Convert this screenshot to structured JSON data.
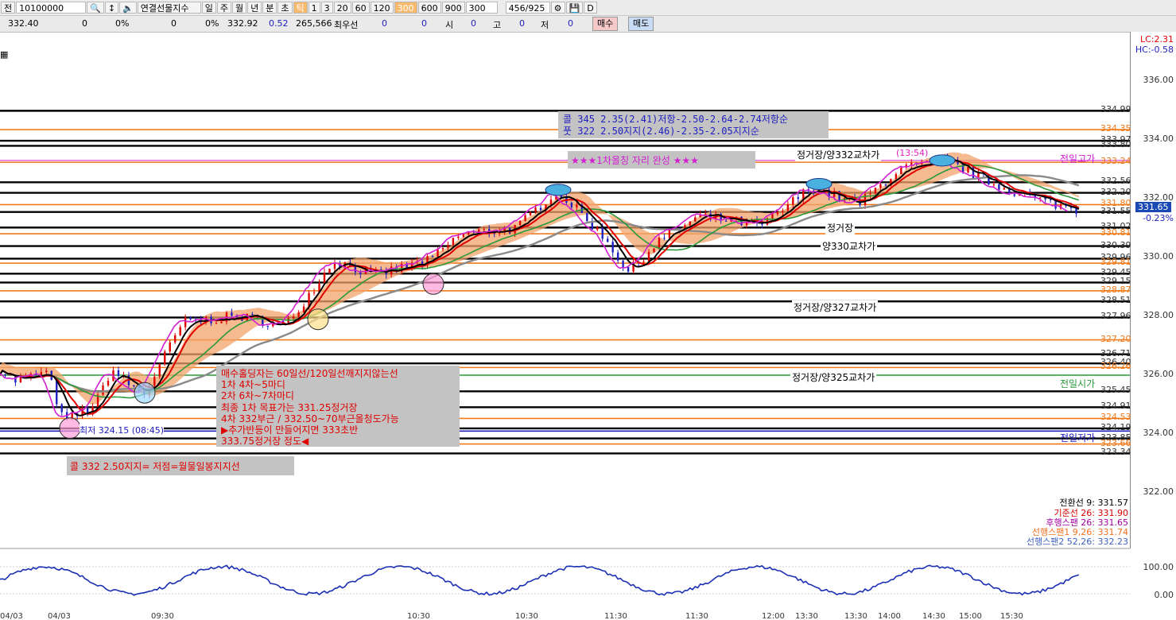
{
  "toolbar": {
    "mode": "전",
    "code": "10100000",
    "name": "연결선물지수",
    "periods": [
      "일",
      "주",
      "월",
      "년",
      "분",
      "초",
      "틱"
    ],
    "nums": [
      "1",
      "3",
      "20",
      "60",
      "120",
      "300",
      "600",
      "900"
    ],
    "count": "300",
    "paging": "456/925",
    "check": "D"
  },
  "quote": {
    "price1": "332.40",
    "v1": "0",
    "p1": "0%",
    "v2": "0",
    "p2": "0%",
    "last": "332.92",
    "chg": "0.52",
    "vol": "265,566",
    "label": "최우선",
    "z1": "0",
    "z2": "0",
    "si": "시",
    "z3": "0",
    "go": "고",
    "z4": "0",
    "jeo": "저",
    "z5": "0",
    "buy": "매수",
    "sell": "매도"
  },
  "axis": {
    "lc": "LC:2.31",
    "hc": "HC:-0.58",
    "ticks": [
      "336.00",
      "334.00",
      "332.00",
      "330.00",
      "328.00",
      "326.00",
      "324.00",
      "322.00"
    ],
    "current": "331.65",
    "current_pct": "-0.23%",
    "ind_ticks": [
      "100.00",
      "0.00"
    ]
  },
  "price_labels": [
    "334.99",
    "334.35",
    "333.97",
    "333.80",
    "333.24",
    "332.56",
    "332.20",
    "331.80",
    "331.55",
    "331.02",
    "330.81",
    "330.39",
    "329.96",
    "329.81",
    "329.45",
    "329.15",
    "328.87",
    "328.51",
    "327.96",
    "327.20",
    "326.71",
    "326.40",
    "326.26",
    "325.45",
    "324.91",
    "324.53",
    "324.19",
    "323.85",
    "323.66",
    "323.34"
  ],
  "markers": {
    "prev_high": "전일고가",
    "prev_open": "전일시가",
    "prev_low": "전일저가",
    "low_note": "최저 324.15 (08:45)",
    "peak_note": "(13:54)"
  },
  "annotations": {
    "top_line1": "콜  345  2.35(2.41)저항-2.50-2.64-2.74저항순",
    "top_line2": "풋  322  2.50지지(2.46)-2.35-2.05지지순",
    "rebound": "★★★1차올칭  자리  완성  ★★★",
    "r332": "정거장/양332교차가",
    "r_station": "정거장",
    "r330": "양330교차가",
    "r327": "정거장/양327교차가",
    "r325": "정거장/양325교차가",
    "bottom": "콜  332  2.50지지=  저점=월물일봉지지선",
    "strategy": [
      "매수홀딩자는  60일선/120일선깨지지않는선",
      "1차  4차~5마디",
      "2차  6차~7차마디",
      "최종  1차  목표가는   331.25정거장",
      "4차  332부근  /   332.50~70부근올청도가능",
      "▶추가반등이  만들어지면  333초반",
      "333.75정거장  정도◀"
    ]
  },
  "legend": [
    {
      "text": "전환선 9: 331.57",
      "color": "#000000"
    },
    {
      "text": "기준선 26: 331.90",
      "color": "#d40000"
    },
    {
      "text": "후행스팬 26: 331.65",
      "color": "#a000a0"
    },
    {
      "text": "선행스팬1 9,26: 331.74",
      "color": "#f07020"
    },
    {
      "text": "선행스팬2 52,26: 332.23",
      "color": "#4060c0"
    }
  ],
  "times": [
    "04/03",
    "04/03",
    "09:30",
    "10:30",
    "10:30",
    "11:30",
    "11:30",
    "12:00",
    "13:30",
    "13:30",
    "14:00",
    "14:30",
    "15:00",
    "15:30"
  ],
  "colors": {
    "black": "#000000",
    "orange": "#f07a1a",
    "red": "#e00000",
    "blue": "#2020c0",
    "purple": "#d020d0",
    "green": "#2a9a3a",
    "grey": "#8a8a8a"
  }
}
